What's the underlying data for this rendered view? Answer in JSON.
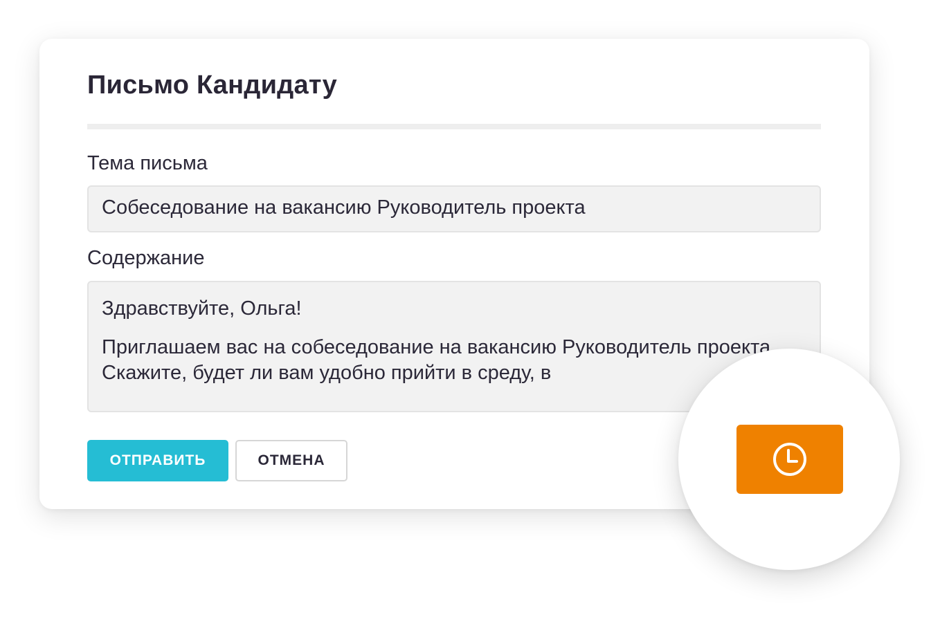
{
  "dialog": {
    "title": "Письмо Кандидату",
    "subject_label": "Тема письма",
    "subject_value": "Собеседование на вакансию Руководитель проекта",
    "content_label": "Содержание",
    "content_greeting": "Здравствуйте, Ольга!",
    "content_body": "Приглашаем вас на собеседование на вакансию Руководитель проекта. Скажите, будет ли вам удобно прийти в среду, в"
  },
  "actions": {
    "send_label": "Отправить",
    "cancel_label": "Отмена",
    "schedule_icon": "clock-icon"
  },
  "colors": {
    "send_button": "#25bdd4",
    "schedule_button": "#ef8100",
    "field_background": "#f2f2f2",
    "title_text": "#2a2636"
  }
}
